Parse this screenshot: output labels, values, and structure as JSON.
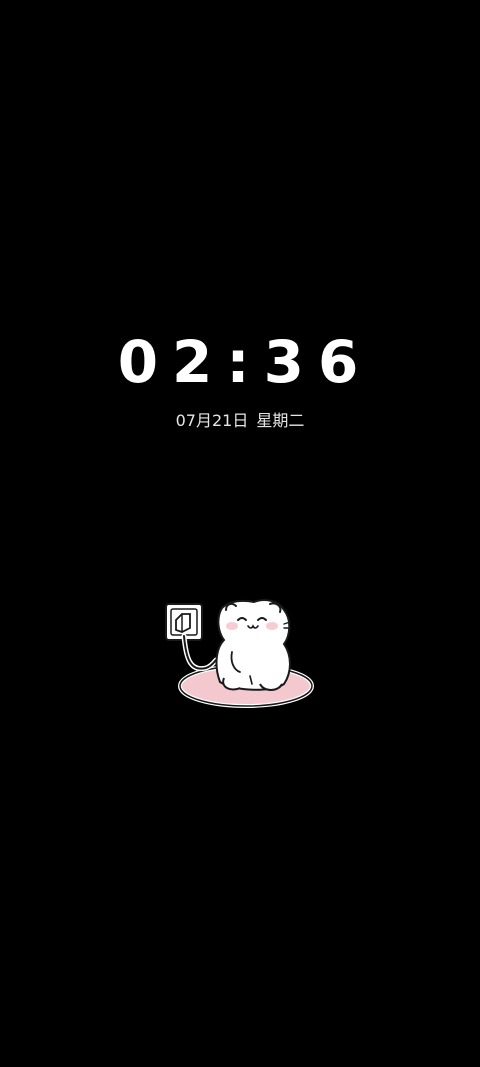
{
  "lockscreen": {
    "time": "02:36",
    "date": "07月21日",
    "weekday": "星期二",
    "illustration_icon": "charging-cat-icon"
  },
  "colors": {
    "background": "#000000",
    "text": "#ffffff",
    "cushion": "#f3c9cf"
  }
}
